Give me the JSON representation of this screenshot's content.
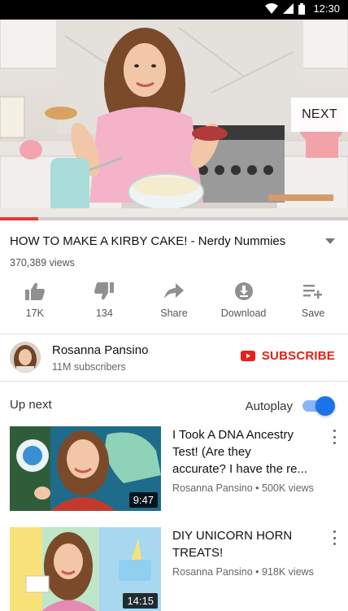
{
  "status_bar": {
    "time": "12:30"
  },
  "player": {
    "next_label": "NEXT",
    "progress": 0.11
  },
  "video": {
    "title": "HOW TO MAKE A KIRBY CAKE! - Nerdy Nummies",
    "views": "370,389 views"
  },
  "actions": [
    {
      "icon": "thumbs-up-icon",
      "label": "17K"
    },
    {
      "icon": "thumbs-down-icon",
      "label": "134"
    },
    {
      "icon": "share-icon",
      "label": "Share"
    },
    {
      "icon": "download-icon",
      "label": "Download"
    },
    {
      "icon": "save-playlist-icon",
      "label": "Save"
    }
  ],
  "channel": {
    "name": "Rosanna Pansino",
    "subscribers": "11M subscribers",
    "subscribe_label": "SUBSCRIBE"
  },
  "up_next": {
    "label": "Up next",
    "autoplay_label": "Autoplay",
    "autoplay_on": true
  },
  "recommendations": [
    {
      "title_line1": "I Took A DNA Ancestry",
      "title_line2": "Test! (Are they",
      "title_line3": "accurate? I have the re...",
      "meta": "Rosanna Pansino • 500K views",
      "duration": "9:47"
    },
    {
      "title_line1": "DIY UNICORN HORN",
      "title_line2": "TREATS!",
      "meta": "Rosanna Pansino • 918K views",
      "duration": "14:15"
    }
  ],
  "colors": {
    "accent_red": "#e62117",
    "progress_red": "#e53935",
    "toggle_blue": "#1a73e8"
  }
}
